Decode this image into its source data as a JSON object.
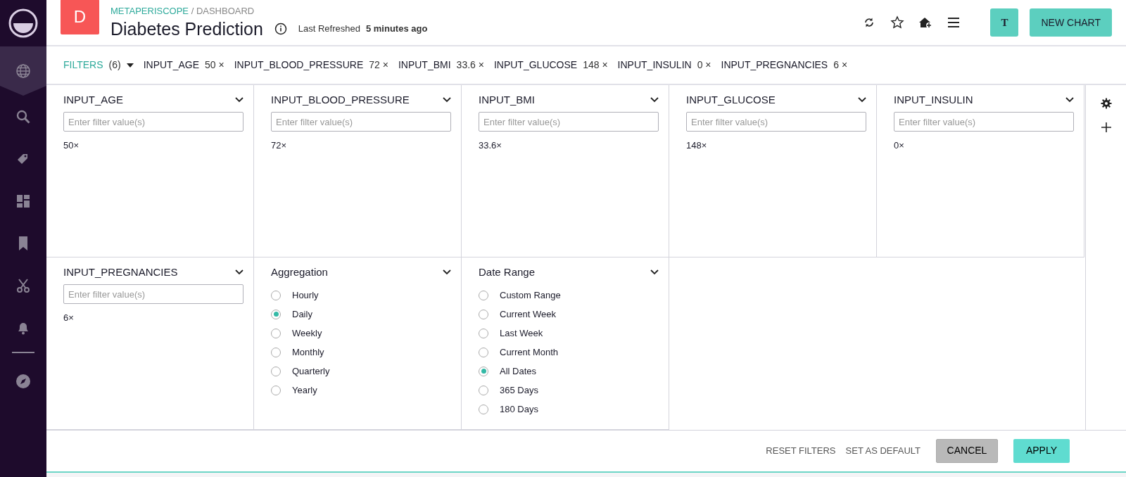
{
  "breadcrumb": {
    "app": "METAPERISCOPE",
    "separator": "/",
    "section": "DASHBOARD"
  },
  "dashboard": {
    "letter": "D",
    "title": "Diabetes Prediction",
    "refreshed_label": "Last Refreshed",
    "refreshed_value": "5 minutes ago"
  },
  "header_buttons": {
    "user_initial": "T",
    "new_chart": "NEW CHART"
  },
  "sidebar": {
    "items": [
      {
        "kind": "globe",
        "selected": true
      },
      {
        "kind": "search",
        "selected": false
      },
      {
        "kind": "tag",
        "selected": false
      },
      {
        "kind": "grid",
        "selected": false
      },
      {
        "kind": "bookmark",
        "selected": false
      },
      {
        "kind": "scissors",
        "selected": false
      },
      {
        "kind": "bell",
        "selected": false
      },
      {
        "kind": "compass",
        "selected": false
      }
    ]
  },
  "filter_bar": {
    "label": "FILTERS",
    "count": "(6)",
    "chips": [
      {
        "name": "INPUT_AGE",
        "value": "50",
        "remove": "×"
      },
      {
        "name": "INPUT_BLOOD_PRESSURE",
        "value": "72",
        "remove": "×"
      },
      {
        "name": "INPUT_BMI",
        "value": "33.6",
        "remove": "×"
      },
      {
        "name": "INPUT_GLUCOSE",
        "value": "148",
        "remove": "×"
      },
      {
        "name": "INPUT_INSULIN",
        "value": "0",
        "remove": "×"
      },
      {
        "name": "INPUT_PREGNANCIES",
        "value": "6",
        "remove": "×"
      }
    ]
  },
  "filters": [
    {
      "kind": "text",
      "title": "INPUT_AGE",
      "placeholder": "Enter filter value(s)",
      "values": [
        "50×"
      ]
    },
    {
      "kind": "text",
      "title": "INPUT_BLOOD_PRESSURE",
      "placeholder": "Enter filter value(s)",
      "values": [
        "72×"
      ]
    },
    {
      "kind": "text",
      "title": "INPUT_BMI",
      "placeholder": "Enter filter value(s)",
      "values": [
        "33.6×"
      ]
    },
    {
      "kind": "text",
      "title": "INPUT_GLUCOSE",
      "placeholder": "Enter filter value(s)",
      "values": [
        "148×"
      ]
    },
    {
      "kind": "text",
      "title": "INPUT_INSULIN",
      "placeholder": "Enter filter value(s)",
      "values": [
        "0×"
      ]
    },
    {
      "kind": "text",
      "title": "INPUT_PREGNANCIES",
      "placeholder": "Enter filter value(s)",
      "values": [
        "6×"
      ]
    },
    {
      "kind": "radio",
      "title": "Aggregation",
      "options": [
        {
          "label": "Hourly",
          "selected": false
        },
        {
          "label": "Daily",
          "selected": true
        },
        {
          "label": "Weekly",
          "selected": false
        },
        {
          "label": "Monthly",
          "selected": false
        },
        {
          "label": "Quarterly",
          "selected": false
        },
        {
          "label": "Yearly",
          "selected": false
        }
      ]
    },
    {
      "kind": "radio",
      "title": "Date Range",
      "options": [
        {
          "label": "Custom Range",
          "selected": false
        },
        {
          "label": "Current Week",
          "selected": false
        },
        {
          "label": "Last Week",
          "selected": false
        },
        {
          "label": "Current Month",
          "selected": false
        },
        {
          "label": "All Dates",
          "selected": true
        },
        {
          "label": "365 Days",
          "selected": false
        },
        {
          "label": "180 Days",
          "selected": false
        }
      ]
    }
  ],
  "footer": {
    "reset": "RESET FILTERS",
    "set_default": "SET AS DEFAULT",
    "cancel": "CANCEL",
    "apply": "APPLY"
  }
}
